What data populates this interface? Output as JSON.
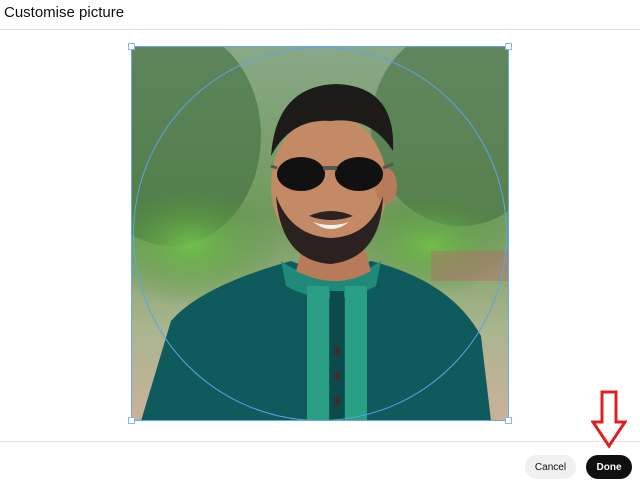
{
  "dialog": {
    "title": "Customise picture"
  },
  "editor": {
    "image_subject": "portrait-photo"
  },
  "footer": {
    "cancel_label": "Cancel",
    "done_label": "Done"
  },
  "colors": {
    "crop_guide": "#5ea3e6",
    "done_button_bg": "#0f0f0f",
    "cancel_button_bg": "#f0f0f0",
    "annotation_arrow": "#e02020"
  },
  "icons": {
    "annotation": "down-arrow-icon"
  }
}
